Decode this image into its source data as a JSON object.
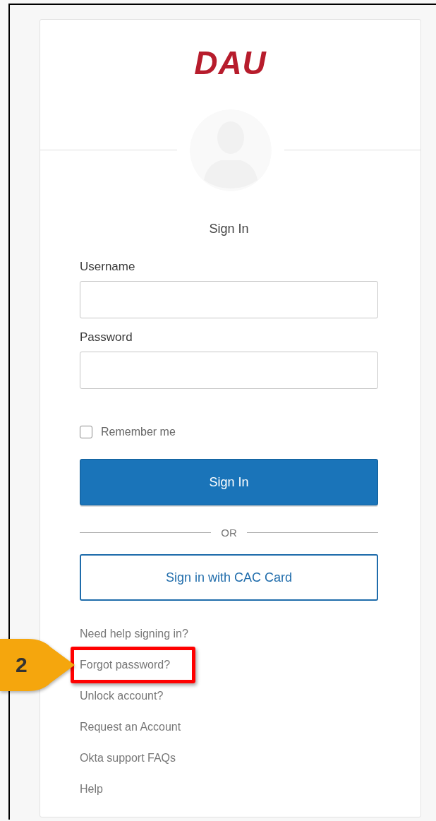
{
  "logo": {
    "text": "DAU"
  },
  "title": "Sign In",
  "fields": [
    {
      "label": "Username"
    },
    {
      "label": "Password"
    }
  ],
  "remember": {
    "label": "Remember me",
    "checked": false
  },
  "sign_in_button": "Sign In",
  "divider_text": "OR",
  "cac_button": "Sign in with CAC Card",
  "links": [
    {
      "text": "Need help signing in?",
      "highlighted": false
    },
    {
      "text": "Forgot password?",
      "highlighted": true,
      "callout": "2"
    },
    {
      "text": "Unlock account?",
      "highlighted": false
    },
    {
      "text": "Request an Account",
      "highlighted": false
    },
    {
      "text": "Okta support FAQs",
      "highlighted": false
    },
    {
      "text": "Help",
      "highlighted": false
    }
  ]
}
